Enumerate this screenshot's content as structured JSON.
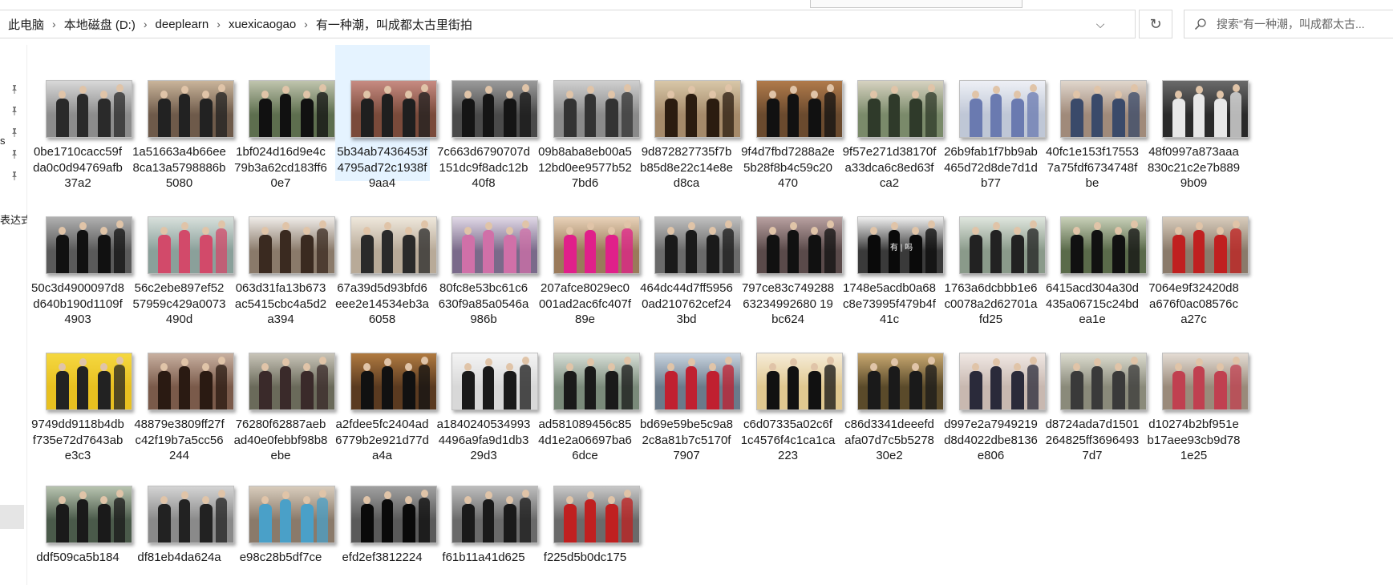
{
  "toolbar_strip": {},
  "address_bar": {
    "breadcrumbs": [
      "此电脑",
      "本地磁盘 (D:)",
      "deeplearn",
      "xuexicaogao",
      "有一种潮，叫成都太古里街拍"
    ],
    "separator": "›",
    "dropdown_glyph": "⌵",
    "refresh_glyph": "↻"
  },
  "search": {
    "placeholder": "搜索\"有一种潮，叫成都太古..."
  },
  "sidebar": {
    "partial_top": "s",
    "partial_text": "表达式"
  },
  "files": [
    {
      "name": "0be1710cacc59fda0c0d94769afb37a2",
      "colors": [
        "#8c8c8c",
        "#d8d8d8",
        "#2a2a2a"
      ]
    },
    {
      "name": "1a51663a4b66ee8ca13a5798886b5080",
      "colors": [
        "#6e5a4a",
        "#c9b49a",
        "#222"
      ]
    },
    {
      "name": "1bf024d16d9e4c79b3a62cd183ff60e7",
      "colors": [
        "#5d6e4e",
        "#bfc4ad",
        "#111"
      ]
    },
    {
      "name": "5b34ab7436453f4795ad72c1938f9aa4",
      "colors": [
        "#7a4a3a",
        "#c78b82",
        "#1f1f1f"
      ],
      "selected": true
    },
    {
      "name": "7c663d6790707d151dc9f8adc12b40f8",
      "colors": [
        "#4a4a4a",
        "#9a9a9a",
        "#151515"
      ]
    },
    {
      "name": "09b8aba8eb00a512bd0ee9577b527bd6",
      "colors": [
        "#8a8a8a",
        "#cfcfcf",
        "#333"
      ]
    },
    {
      "name": "9d872827735f7bb85d8e22c14e8ed8ca",
      "colors": [
        "#a58a6a",
        "#d8c7a8",
        "#2b1c10"
      ]
    },
    {
      "name": "9f4d7fbd7288a2e5b28f8b4c59c20470",
      "colors": [
        "#6a4a2e",
        "#b07a4a",
        "#111"
      ]
    },
    {
      "name": "9f57e271d38170fa33dca6c8ed63fca2",
      "colors": [
        "#7a8a6a",
        "#d6d2c0",
        "#2f3a2a"
      ]
    },
    {
      "name": "26b9fab1f7bb9ab465d72d8de7d1db77",
      "colors": [
        "#bfc7d6",
        "#eef0f6",
        "#6a7ab0"
      ]
    },
    {
      "name": "40fc1e153f175537a75fdf6734748fbe",
      "colors": [
        "#a08a7a",
        "#e0d6cc",
        "#3a4a6a"
      ]
    },
    {
      "name": "48f0997a873aaa830c21c2e7b8899b09",
      "colors": [
        "#2a2a2a",
        "#6a6a6a",
        "#e8e8e8"
      ]
    },
    {
      "name": "50c3d4900097d8d640b190d1109f4903",
      "colors": [
        "#5a5a5a",
        "#b0b0b0",
        "#111"
      ]
    },
    {
      "name": "56c2ebe897ef5257959c429a0073490d",
      "colors": [
        "#8aa09a",
        "#d8e0dc",
        "#d24a6a"
      ]
    },
    {
      "name": "063d31fa13b673ac5415cbc4a5d2a394",
      "colors": [
        "#8a7a6a",
        "#efece8",
        "#3a2a20"
      ]
    },
    {
      "name": "67a39d5d93bfd6eee2e14534eb3a6058",
      "colors": [
        "#b8aa98",
        "#efe8dc",
        "#2a2a2a"
      ]
    },
    {
      "name": "80fc8e53bc61c6630f9a85a0546a986b",
      "colors": [
        "#7a6a8a",
        "#e0d8e6",
        "#d070a8"
      ]
    },
    {
      "name": "207afce8029ec0001ad2ac6fc407f89e",
      "colors": [
        "#9a7a5a",
        "#e8d2b8",
        "#e0208a"
      ]
    },
    {
      "name": "464dc44d7ff59560ad210762cef243bd",
      "colors": [
        "#6a6a6a",
        "#c0c0c0",
        "#1a1a1a"
      ]
    },
    {
      "name": "797ce83c74928863234992680 19bc624",
      "colors": [
        "#5a4a4a",
        "#b8a0a0",
        "#111"
      ]
    },
    {
      "name": "1748e5acdb0a68c8e73995f479b4f41c",
      "colors": [
        "#3a3a3a",
        "#f0f0f0",
        "#0a0a0a"
      ],
      "overlay": "有 | 吗"
    },
    {
      "name": "1763a6dcbbb1e6c0078a2d62701afd25",
      "colors": [
        "#8a9a8a",
        "#dfe6de",
        "#222"
      ]
    },
    {
      "name": "6415acd304a30d435a06715c24bdea1e",
      "colors": [
        "#5a6a4a",
        "#c8d0b8",
        "#111"
      ]
    },
    {
      "name": "7064e9f32420d8a676f0ac08576ca27c",
      "colors": [
        "#8a7a6a",
        "#d8ccbc",
        "#c02020"
      ]
    },
    {
      "name": "9749dd9118b4dbf735e72d7643abe3c3",
      "colors": [
        "#e8c020",
        "#f5d840",
        "#222"
      ]
    },
    {
      "name": "48879e3809ff27fc42f19b7a5cc56244",
      "colors": [
        "#7a5a4a",
        "#c8b0a0",
        "#2a1a12"
      ]
    },
    {
      "name": "76280f62887aebad40e0febbf98b8ebe",
      "colors": [
        "#6a6a5a",
        "#c8c4b8",
        "#3a2a2a"
      ]
    },
    {
      "name": "a2fdee5fc2404ad6779b2e921d77da4a",
      "colors": [
        "#5a3a20",
        "#b07a40",
        "#111"
      ]
    },
    {
      "name": "a18402405349934496a9fa9d1db329d3",
      "colors": [
        "#d8d8d8",
        "#f4f4f4",
        "#1a1a1a"
      ]
    },
    {
      "name": "ad581089456c854d1e2a06697ba66dce",
      "colors": [
        "#7a8a7a",
        "#d8e0d8",
        "#1a1a1a"
      ]
    },
    {
      "name": "bd69e59be5c9a82c8a81b7c5170f7907",
      "colors": [
        "#6a7a8a",
        "#c8d4e0",
        "#c02030"
      ]
    },
    {
      "name": "c6d07335a02c6f1c4576f4c1ca1ca223",
      "colors": [
        "#e0c890",
        "#f6ecd8",
        "#111"
      ]
    },
    {
      "name": "c86d3341deeefdafa07d7c5b527830e2",
      "colors": [
        "#5a4a2a",
        "#c8a870",
        "#1a1a1a"
      ]
    },
    {
      "name": "d997e2a7949219d8d4022dbe8136e806",
      "colors": [
        "#c8b8b0",
        "#f0e8e4",
        "#2a2a3a"
      ]
    },
    {
      "name": "d8724ada7d1501264825ff36964937d7",
      "colors": [
        "#8a8a7a",
        "#dcdcd0",
        "#3a3a3a"
      ]
    },
    {
      "name": "d10274b2bf951eb17aee93cb9d781e25",
      "colors": [
        "#9a8a7a",
        "#e4dcd4",
        "#c04050"
      ]
    },
    {
      "name": "ddf509ca5b184",
      "colors": [
        "#4a5a4a",
        "#b8c4b0",
        "#1a1a1a"
      ]
    },
    {
      "name": "df81eb4da624a",
      "colors": [
        "#8a8a8a",
        "#d4d4d4",
        "#222"
      ]
    },
    {
      "name": "e98c28b5df7ce",
      "colors": [
        "#8a7a6a",
        "#d8ccbc",
        "#4aa0c8"
      ]
    },
    {
      "name": "efd2ef3812224",
      "colors": [
        "#5a5a5a",
        "#a0a0a0",
        "#0a0a0a"
      ]
    },
    {
      "name": "f61b11a41d625",
      "colors": [
        "#6a6a6a",
        "#bdbdbd",
        "#1a1a1a"
      ]
    },
    {
      "name": "f225d5b0dc175",
      "colors": [
        "#6a6a6a",
        "#c8c8c8",
        "#c02020"
      ]
    }
  ]
}
